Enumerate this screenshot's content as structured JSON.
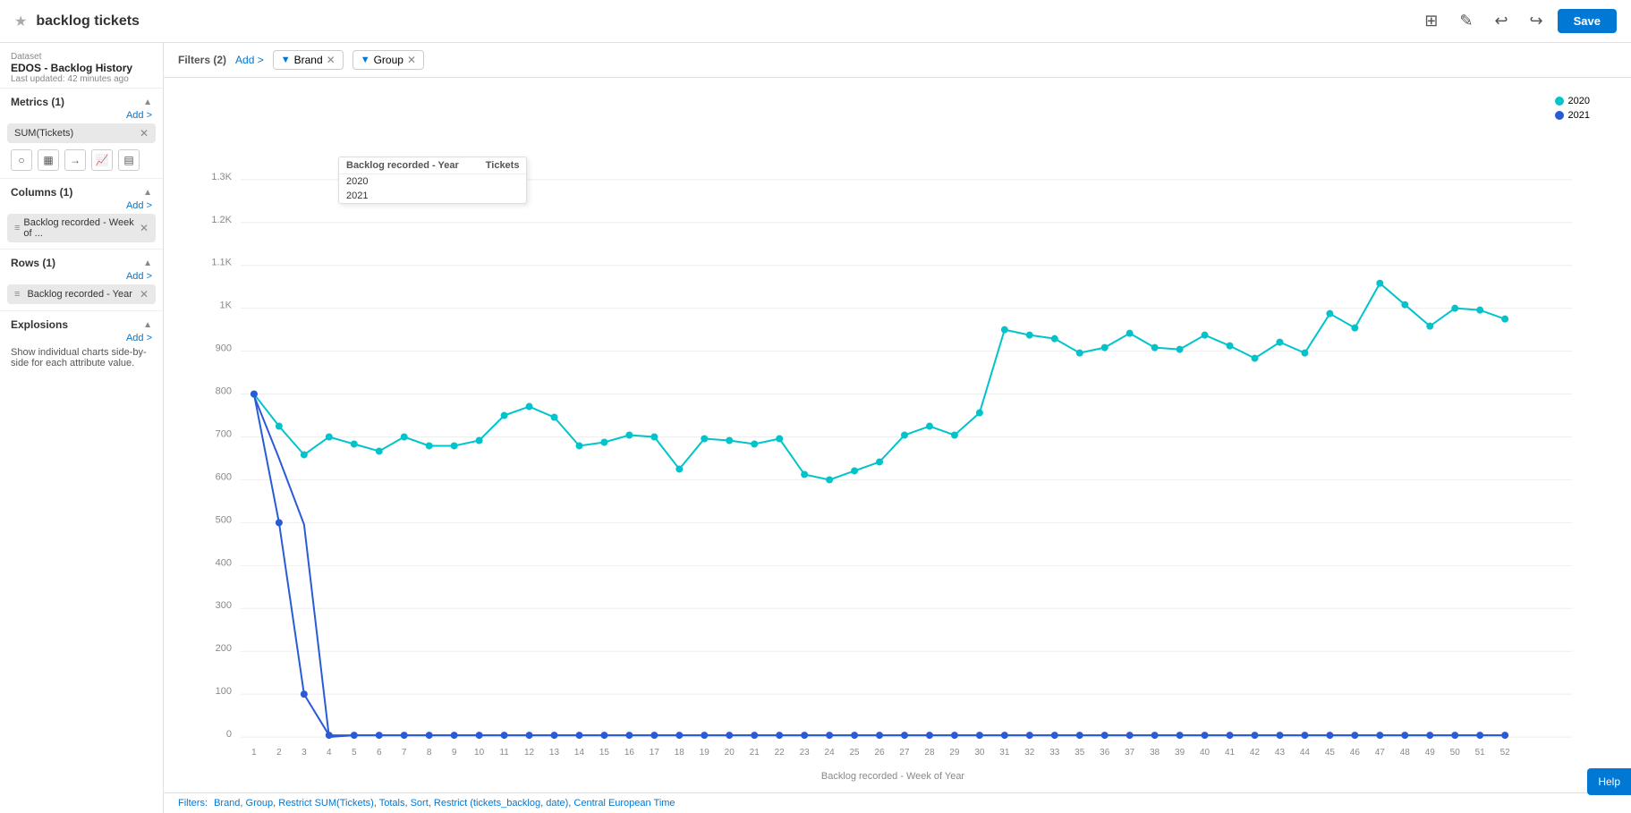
{
  "topbar": {
    "icon": "★",
    "title": "backlog tickets",
    "save_label": "Save",
    "undo_icon": "↩",
    "redo_icon": "↪",
    "grid_icon": "⊞",
    "edit_icon": "✎"
  },
  "sidebar": {
    "dataset_label": "Dataset",
    "dataset_name": "EDOS - Backlog History",
    "dataset_updated": "Last updated: 42 minutes ago",
    "metrics_section": "Metrics (1)",
    "metrics_add": "Add >",
    "metrics_pill": "SUM(Tickets)",
    "columns_section": "Columns (1)",
    "columns_add": "Add >",
    "columns_pill": "Backlog recorded - Week of ...",
    "rows_section": "Rows (1)",
    "rows_add": "Add >",
    "rows_pill": "Backlog recorded - Year",
    "explosions_section": "Explosions",
    "explosions_add": "Add >",
    "explosions_desc": "Show individual charts side-by-side for each attribute value."
  },
  "filterbar": {
    "label": "Filters (2)",
    "add_label": "Add >",
    "chip1_label": "Brand",
    "chip2_label": "Group"
  },
  "tooltip_table": {
    "col1": "Backlog recorded - Year",
    "col2": "Tickets",
    "rows": [
      {
        "year": "2020",
        "tickets": ""
      },
      {
        "year": "2021",
        "tickets": ""
      }
    ]
  },
  "chart": {
    "x_axis_label": "Backlog recorded - Week of Year",
    "y_labels": [
      "0",
      "100",
      "200",
      "300",
      "400",
      "500",
      "600",
      "700",
      "800",
      "900",
      "1K",
      "1.1K",
      "1.2K",
      "1.3K"
    ],
    "x_labels": [
      "1",
      "2",
      "3",
      "4",
      "5",
      "6",
      "7",
      "8",
      "9",
      "10",
      "11",
      "12",
      "13",
      "14",
      "15",
      "16",
      "17",
      "18",
      "19",
      "20",
      "21",
      "22",
      "23",
      "24",
      "25",
      "26",
      "27",
      "28",
      "29",
      "30",
      "31",
      "32",
      "33",
      "35",
      "36",
      "37",
      "38",
      "39",
      "40",
      "41",
      "42",
      "43",
      "44",
      "45",
      "46",
      "47",
      "48",
      "49",
      "50",
      "51",
      "52"
    ],
    "legend": [
      {
        "label": "2020",
        "color": "#00c4cc"
      },
      {
        "label": "2021",
        "color": "#2a5bd7"
      }
    ]
  },
  "bottom_filters": {
    "prefix": "Filters:",
    "items": [
      "Brand",
      "Group",
      "Restrict SUM(Tickets)",
      "Totals",
      "Sort",
      "Restrict (tickets_backlog, date)",
      "Central European Time"
    ]
  },
  "help_btn": "Help"
}
